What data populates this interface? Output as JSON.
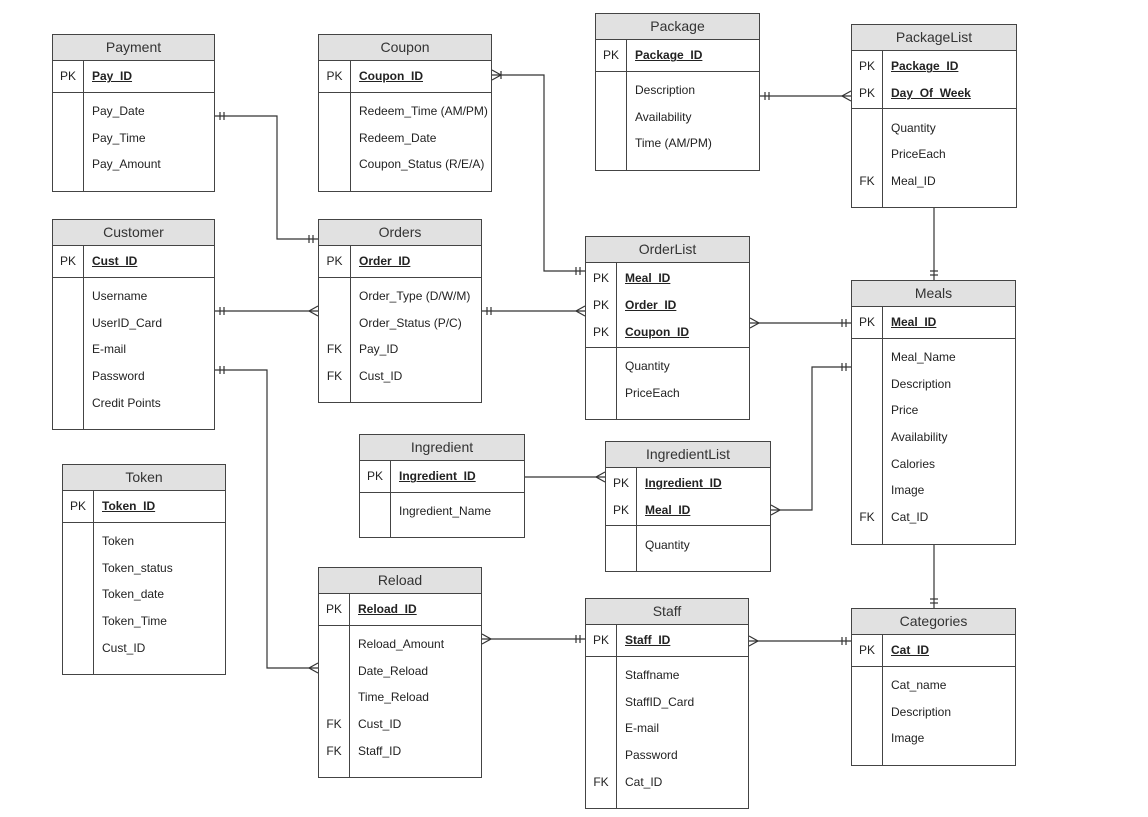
{
  "diagram": {
    "type": "entity-relationship",
    "entities": {
      "payment": {
        "name": "Payment",
        "keys": [
          {
            "kind": "PK",
            "field": "Pay_ID"
          }
        ],
        "attributes": [
          {
            "kind": "",
            "field": "Pay_Date"
          },
          {
            "kind": "",
            "field": "Pay_Time"
          },
          {
            "kind": "",
            "field": "Pay_Amount"
          }
        ]
      },
      "coupon": {
        "name": "Coupon",
        "keys": [
          {
            "kind": "PK",
            "field": "Coupon_ID"
          }
        ],
        "attributes": [
          {
            "kind": "",
            "field": "Redeem_Time (AM/PM)"
          },
          {
            "kind": "",
            "field": "Redeem_Date"
          },
          {
            "kind": "",
            "field": "Coupon_Status (R/E/A)"
          }
        ]
      },
      "package": {
        "name": "Package",
        "keys": [
          {
            "kind": "PK",
            "field": "Package_ID"
          }
        ],
        "attributes": [
          {
            "kind": "",
            "field": "Description"
          },
          {
            "kind": "",
            "field": "Availability"
          },
          {
            "kind": "",
            "field": "Time (AM/PM)"
          }
        ]
      },
      "packagelist": {
        "name": "PackageList",
        "keys": [
          {
            "kind": "PK",
            "field": "Package_ID"
          },
          {
            "kind": "PK",
            "field": "Day_Of_Week"
          }
        ],
        "attributes": [
          {
            "kind": "",
            "field": "Quantity"
          },
          {
            "kind": "",
            "field": "PriceEach"
          },
          {
            "kind": "FK",
            "field": "Meal_ID"
          }
        ]
      },
      "customer": {
        "name": "Customer",
        "keys": [
          {
            "kind": "PK",
            "field": "Cust_ID"
          }
        ],
        "attributes": [
          {
            "kind": "",
            "field": "Username"
          },
          {
            "kind": "",
            "field": "UserID_Card"
          },
          {
            "kind": "",
            "field": "E-mail"
          },
          {
            "kind": "",
            "field": "Password"
          },
          {
            "kind": "",
            "field": "Credit Points"
          }
        ]
      },
      "orders": {
        "name": "Orders",
        "keys": [
          {
            "kind": "PK",
            "field": "Order_ID"
          }
        ],
        "attributes": [
          {
            "kind": "",
            "field": "Order_Type (D/W/M)"
          },
          {
            "kind": "",
            "field": "Order_Status (P/C)"
          },
          {
            "kind": "FK",
            "field": "Pay_ID"
          },
          {
            "kind": "FK",
            "field": "Cust_ID"
          }
        ]
      },
      "orderlist": {
        "name": "OrderList",
        "keys": [
          {
            "kind": "PK",
            "field": "Meal_ID"
          },
          {
            "kind": "PK",
            "field": "Order_ID"
          },
          {
            "kind": "PK",
            "field": "Coupon_ID"
          }
        ],
        "attributes": [
          {
            "kind": "",
            "field": "Quantity"
          },
          {
            "kind": "",
            "field": "PriceEach"
          }
        ]
      },
      "meals": {
        "name": "Meals",
        "keys": [
          {
            "kind": "PK",
            "field": "Meal_ID"
          }
        ],
        "attributes": [
          {
            "kind": "",
            "field": "Meal_Name"
          },
          {
            "kind": "",
            "field": "Description"
          },
          {
            "kind": "",
            "field": "Price"
          },
          {
            "kind": "",
            "field": "Availability"
          },
          {
            "kind": "",
            "field": "Calories"
          },
          {
            "kind": "",
            "field": "Image"
          },
          {
            "kind": "FK",
            "field": "Cat_ID"
          }
        ]
      },
      "ingredient": {
        "name": "Ingredient",
        "keys": [
          {
            "kind": "PK",
            "field": "Ingredient_ID"
          }
        ],
        "attributes": [
          {
            "kind": "",
            "field": "Ingredient_Name"
          }
        ]
      },
      "ingredientlist": {
        "name": "IngredientList",
        "keys": [
          {
            "kind": "PK",
            "field": "Ingredient_ID"
          },
          {
            "kind": "PK",
            "field": "Meal_ID"
          }
        ],
        "attributes": [
          {
            "kind": "",
            "field": "Quantity"
          }
        ]
      },
      "token": {
        "name": "Token",
        "keys": [
          {
            "kind": "PK",
            "field": "Token_ID"
          }
        ],
        "attributes": [
          {
            "kind": "",
            "field": "Token"
          },
          {
            "kind": "",
            "field": "Token_status"
          },
          {
            "kind": "",
            "field": "Token_date"
          },
          {
            "kind": "",
            "field": "Token_Time"
          },
          {
            "kind": "",
            "field": "Cust_ID"
          }
        ]
      },
      "reload": {
        "name": "Reload",
        "keys": [
          {
            "kind": "PK",
            "field": "Reload_ID"
          }
        ],
        "attributes": [
          {
            "kind": "",
            "field": "Reload_Amount"
          },
          {
            "kind": "",
            "field": "Date_Reload"
          },
          {
            "kind": "",
            "field": "Time_Reload"
          },
          {
            "kind": "FK",
            "field": "Cust_ID"
          },
          {
            "kind": "FK",
            "field": "Staff_ID"
          }
        ]
      },
      "staff": {
        "name": "Staff",
        "keys": [
          {
            "kind": "PK",
            "field": "Staff_ID"
          }
        ],
        "attributes": [
          {
            "kind": "",
            "field": "Staffname"
          },
          {
            "kind": "",
            "field": "StaffID_Card"
          },
          {
            "kind": "",
            "field": "E-mail"
          },
          {
            "kind": "",
            "field": "Password"
          },
          {
            "kind": "FK",
            "field": "Cat_ID"
          }
        ]
      },
      "categories": {
        "name": "Categories",
        "keys": [
          {
            "kind": "PK",
            "field": "Cat_ID"
          }
        ],
        "attributes": [
          {
            "kind": "",
            "field": "Cat_name"
          },
          {
            "kind": "",
            "field": "Description"
          },
          {
            "kind": "",
            "field": "Image"
          }
        ]
      }
    },
    "relationships": [
      {
        "from": "Payment",
        "from_card": "one-and-only-one",
        "to": "Orders",
        "to_card": "one-and-only-one"
      },
      {
        "from": "Customer",
        "from_card": "one-and-only-one",
        "to": "Orders",
        "to_card": "many"
      },
      {
        "from": "Customer",
        "from_card": "one-and-only-one",
        "to": "Reload",
        "to_card": "many"
      },
      {
        "from": "Coupon",
        "from_card": "one-or-many",
        "to": "OrderList",
        "to_card": "one-and-only-one"
      },
      {
        "from": "Orders",
        "from_card": "one-and-only-one",
        "to": "OrderList",
        "to_card": "many"
      },
      {
        "from": "OrderList",
        "from_card": "many",
        "to": "Meals",
        "to_card": "one-and-only-one"
      },
      {
        "from": "Package",
        "from_card": "one-and-only-one",
        "to": "PackageList",
        "to_card": "many"
      },
      {
        "from": "PackageList",
        "from_card": "many",
        "to": "Meals",
        "to_card": "one-and-only-one"
      },
      {
        "from": "Ingredient",
        "from_card": "one",
        "to": "IngredientList",
        "to_card": "many"
      },
      {
        "from": "IngredientList",
        "from_card": "many",
        "to": "Meals",
        "to_card": "one-and-only-one"
      },
      {
        "from": "Meals",
        "from_card": "many",
        "to": "Categories",
        "to_card": "one-and-only-one"
      },
      {
        "from": "Reload",
        "from_card": "many",
        "to": "Staff",
        "to_card": "one-and-only-one"
      },
      {
        "from": "Staff",
        "from_card": "many",
        "to": "Categories",
        "to_card": "one-and-only-one"
      }
    ]
  }
}
